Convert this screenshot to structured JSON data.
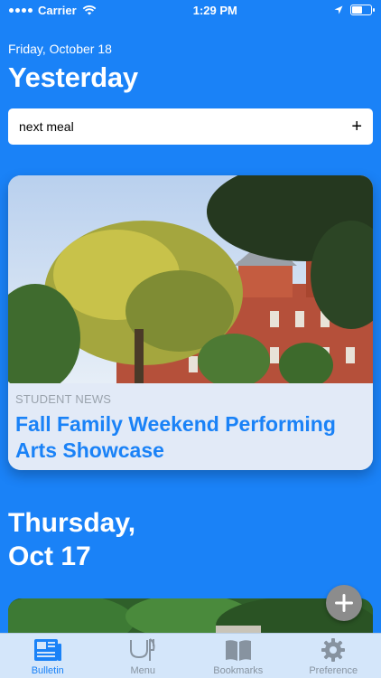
{
  "status_bar": {
    "carrier": "Carrier",
    "time": "1:29 PM"
  },
  "header": {
    "date": "Friday, October 18",
    "title": "Yesterday"
  },
  "search": {
    "value": "next meal",
    "add_icon": "plus-icon"
  },
  "featured_card": {
    "category": "STUDENT NEWS",
    "title": "Fall Family Weekend Performing Arts Showcase"
  },
  "section": {
    "title_line1": "Thursday,",
    "title_line2": "Oct 17"
  },
  "fab": {
    "icon": "plus-icon"
  },
  "tab_bar": {
    "active_color": "#1a82f7",
    "inactive_color": "#8793a0",
    "tabs": [
      {
        "label": "Bulletin",
        "icon": "newspaper-icon",
        "active": true
      },
      {
        "label": "Menu",
        "icon": "fork-knife-icon",
        "active": false
      },
      {
        "label": "Bookmarks",
        "icon": "book-icon",
        "active": false
      },
      {
        "label": "Preference",
        "icon": "gear-icon",
        "active": false
      }
    ]
  },
  "colors": {
    "background": "#1a82f7",
    "accent": "#1a82f7"
  }
}
